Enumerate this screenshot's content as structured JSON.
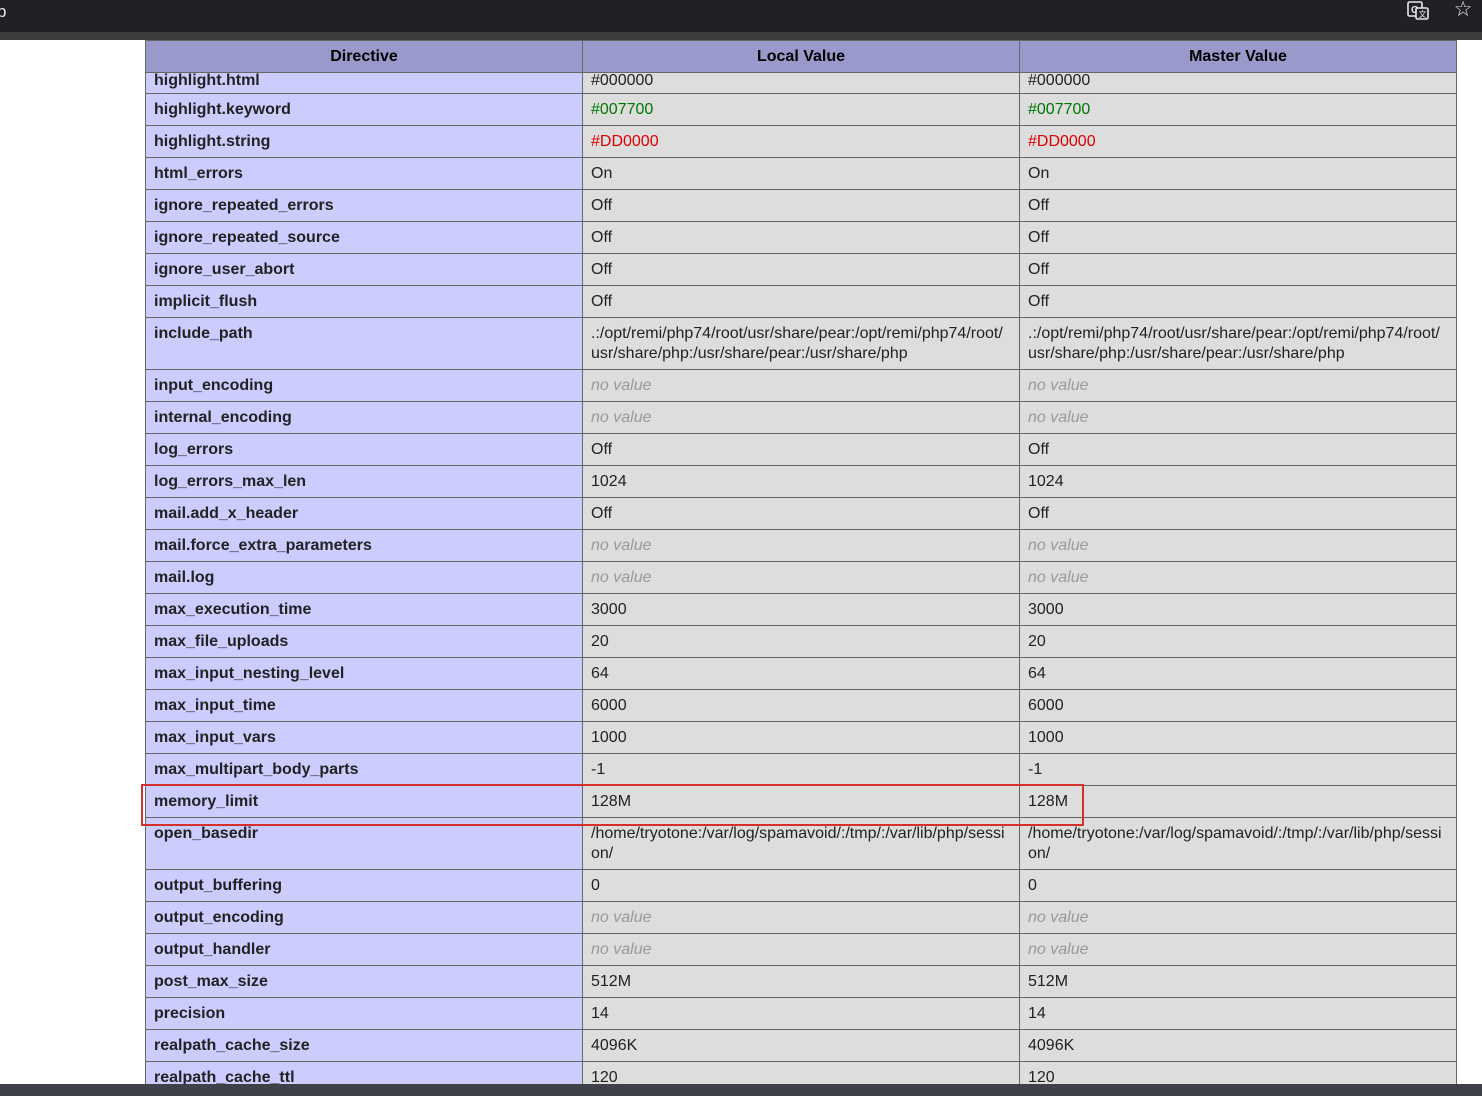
{
  "browser": {
    "tab_edge_text": "p",
    "icons": {
      "translate": "translate-icon",
      "bookmark": "star-icon"
    }
  },
  "table": {
    "headers": {
      "directive": "Directive",
      "local": "Local Value",
      "master": "Master Value"
    },
    "rows": [
      {
        "directive": "highlight.html",
        "local": "#000000",
        "master": "#000000",
        "style": "normal"
      },
      {
        "directive": "highlight.keyword",
        "local": "#007700",
        "master": "#007700",
        "style": "green"
      },
      {
        "directive": "highlight.string",
        "local": "#DD0000",
        "master": "#DD0000",
        "style": "red"
      },
      {
        "directive": "html_errors",
        "local": "On",
        "master": "On",
        "style": "normal"
      },
      {
        "directive": "ignore_repeated_errors",
        "local": "Off",
        "master": "Off",
        "style": "normal"
      },
      {
        "directive": "ignore_repeated_source",
        "local": "Off",
        "master": "Off",
        "style": "normal"
      },
      {
        "directive": "ignore_user_abort",
        "local": "Off",
        "master": "Off",
        "style": "normal"
      },
      {
        "directive": "implicit_flush",
        "local": "Off",
        "master": "Off",
        "style": "normal"
      },
      {
        "directive": "include_path",
        "local": ".:/opt/remi/php74/root/usr/share/pear:/opt/remi/php74/root/usr/share/php:/usr/share/pear:/usr/share/php",
        "master": ".:/opt/remi/php74/root/usr/share/pear:/opt/remi/php74/root/usr/share/php:/usr/share/pear:/usr/share/php",
        "style": "normal"
      },
      {
        "directive": "input_encoding",
        "local": "no value",
        "master": "no value",
        "style": "novalue"
      },
      {
        "directive": "internal_encoding",
        "local": "no value",
        "master": "no value",
        "style": "novalue"
      },
      {
        "directive": "log_errors",
        "local": "Off",
        "master": "Off",
        "style": "normal"
      },
      {
        "directive": "log_errors_max_len",
        "local": "1024",
        "master": "1024",
        "style": "normal"
      },
      {
        "directive": "mail.add_x_header",
        "local": "Off",
        "master": "Off",
        "style": "normal"
      },
      {
        "directive": "mail.force_extra_parameters",
        "local": "no value",
        "master": "no value",
        "style": "novalue"
      },
      {
        "directive": "mail.log",
        "local": "no value",
        "master": "no value",
        "style": "novalue"
      },
      {
        "directive": "max_execution_time",
        "local": "3000",
        "master": "3000",
        "style": "normal"
      },
      {
        "directive": "max_file_uploads",
        "local": "20",
        "master": "20",
        "style": "normal"
      },
      {
        "directive": "max_input_nesting_level",
        "local": "64",
        "master": "64",
        "style": "normal"
      },
      {
        "directive": "max_input_time",
        "local": "6000",
        "master": "6000",
        "style": "normal"
      },
      {
        "directive": "max_input_vars",
        "local": "1000",
        "master": "1000",
        "style": "normal"
      },
      {
        "directive": "max_multipart_body_parts",
        "local": "-1",
        "master": "-1",
        "style": "normal"
      },
      {
        "directive": "memory_limit",
        "local": "128M",
        "master": "128M",
        "style": "normal"
      },
      {
        "directive": "open_basedir",
        "local": "/home/tryotone:/var/log/spamavoid/:/tmp/:/var/lib/php/session/",
        "master": "/home/tryotone:/var/log/spamavoid/:/tmp/:/var/lib/php/session/",
        "style": "normal"
      },
      {
        "directive": "output_buffering",
        "local": "0",
        "master": "0",
        "style": "normal"
      },
      {
        "directive": "output_encoding",
        "local": "no value",
        "master": "no value",
        "style": "novalue"
      },
      {
        "directive": "output_handler",
        "local": "no value",
        "master": "no value",
        "style": "novalue"
      },
      {
        "directive": "post_max_size",
        "local": "512M",
        "master": "512M",
        "style": "normal"
      },
      {
        "directive": "precision",
        "local": "14",
        "master": "14",
        "style": "normal"
      },
      {
        "directive": "realpath_cache_size",
        "local": "4096K",
        "master": "4096K",
        "style": "normal"
      },
      {
        "directive": "realpath_cache_ttl",
        "local": "120",
        "master": "120",
        "style": "normal"
      }
    ]
  },
  "highlighted_row": "memory_limit",
  "colors": {
    "header_bg": "#9999cc",
    "directive_bg": "#ccccff",
    "value_bg": "#dddddd",
    "keyword_green": "#007700",
    "string_red": "#dd0000",
    "highlight_box": "#d3312b"
  }
}
